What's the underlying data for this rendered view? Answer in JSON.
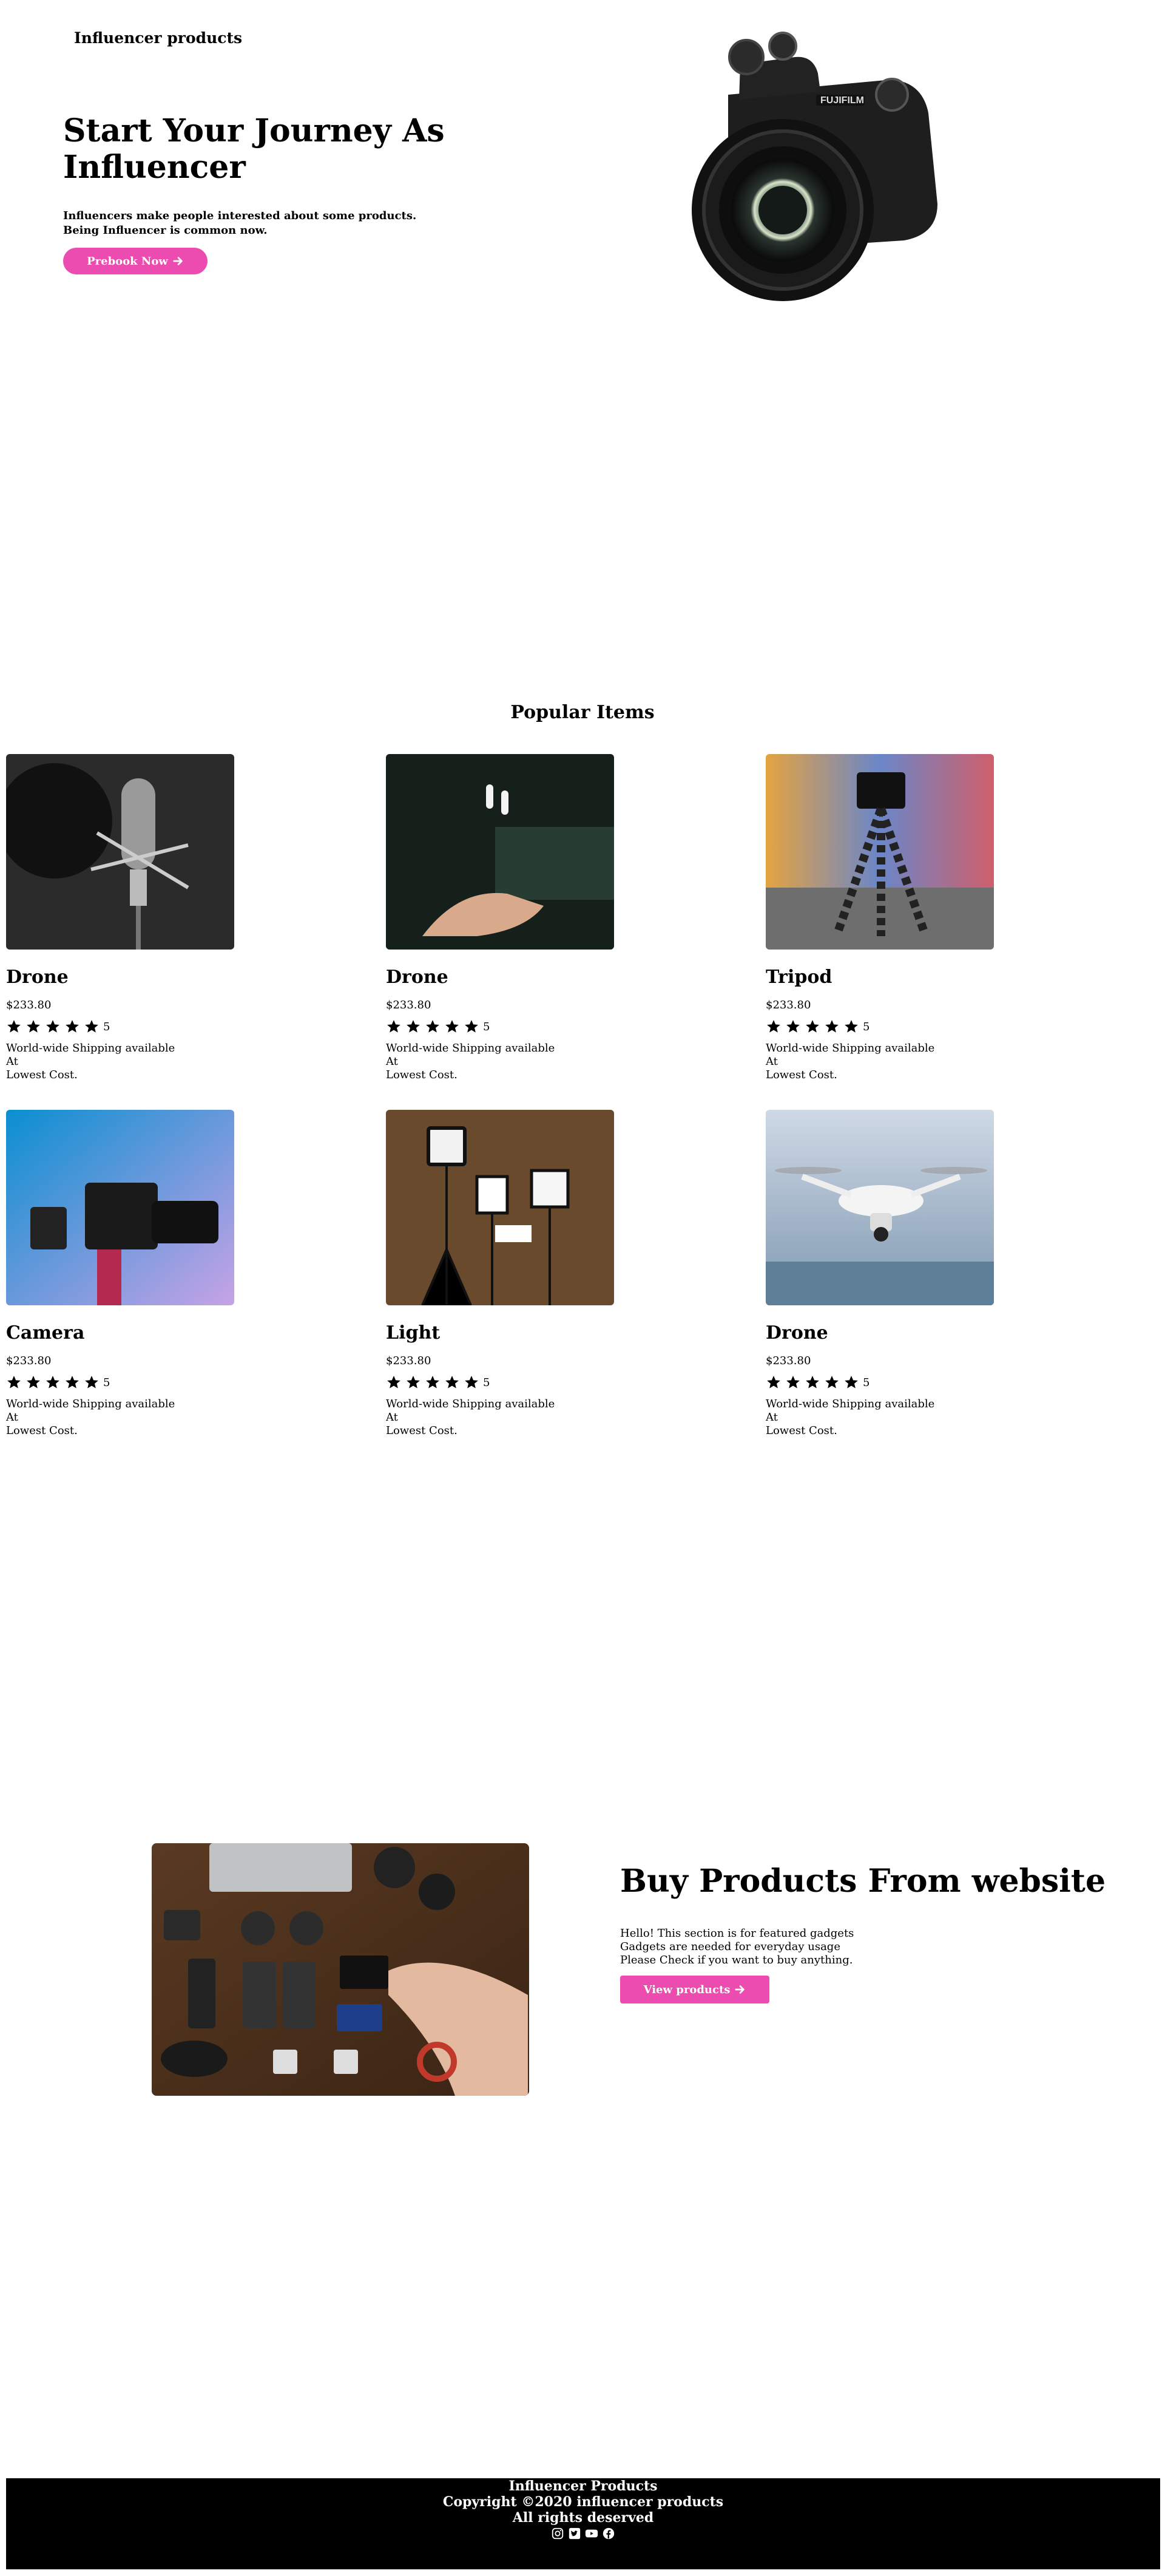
{
  "header": {
    "brand": "Influencer products"
  },
  "hero": {
    "title": "Start Your Journey As Influencer",
    "subtitle_line1": "Influencers make people interested about some products.",
    "subtitle_line2": "Being Influencer is common now.",
    "cta_label": "Prebook Now"
  },
  "popular": {
    "title": "Popular Items",
    "items": [
      {
        "name": "Drone",
        "price": "$233.80",
        "rating": 5,
        "rating_text": "5",
        "ship1": "World-wide Shipping available",
        "ship2": "At",
        "ship3": "Lowest Cost."
      },
      {
        "name": "Drone",
        "price": "$233.80",
        "rating": 5,
        "rating_text": "5",
        "ship1": "World-wide Shipping available",
        "ship2": "At",
        "ship3": "Lowest Cost."
      },
      {
        "name": "Tripod",
        "price": "$233.80",
        "rating": 5,
        "rating_text": "5",
        "ship1": "World-wide Shipping available",
        "ship2": "At",
        "ship3": "Lowest Cost."
      },
      {
        "name": "Camera",
        "price": "$233.80",
        "rating": 5,
        "rating_text": "5",
        "ship1": "World-wide Shipping available",
        "ship2": "At",
        "ship3": "Lowest Cost."
      },
      {
        "name": "Light",
        "price": "$233.80",
        "rating": 5,
        "rating_text": "5",
        "ship1": "World-wide Shipping available",
        "ship2": "At",
        "ship3": "Lowest Cost."
      },
      {
        "name": "Drone",
        "price": "$233.80",
        "rating": 5,
        "rating_text": "5",
        "ship1": "World-wide Shipping available",
        "ship2": "At",
        "ship3": "Lowest Cost."
      }
    ]
  },
  "buy": {
    "title": "Buy Products From website",
    "line1": "Hello! This section is for featured gadgets",
    "line2": "Gadgets are needed for everyday usage",
    "line3": "Please Check if you want to buy anything.",
    "cta_label": "View products"
  },
  "footer": {
    "brand": "Influencer Products",
    "copyright": "Copyright ©2020 influencer products",
    "rights": "All rights deserved",
    "socials": [
      "instagram-icon",
      "twitter-icon",
      "youtube-icon",
      "facebook-icon"
    ]
  },
  "colors": {
    "accent": "#ec4bb0",
    "footer_bg": "#000000"
  }
}
